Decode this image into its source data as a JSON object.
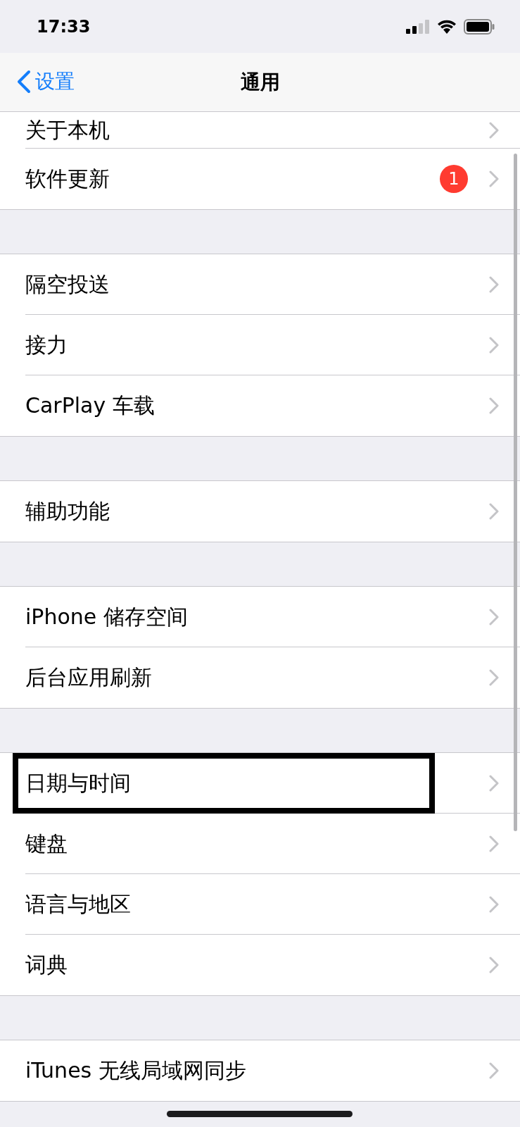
{
  "status_bar": {
    "time": "17:33"
  },
  "nav": {
    "back_label": "设置",
    "title": "通用"
  },
  "groups": [
    [
      {
        "label": "关于本机",
        "highlighted": false,
        "cut": true
      },
      {
        "label": "软件更新",
        "badge": "1",
        "highlighted": false
      }
    ],
    [
      {
        "label": "隔空投送",
        "highlighted": false
      },
      {
        "label": "接力",
        "highlighted": false
      },
      {
        "label": "CarPlay 车载",
        "highlighted": false
      }
    ],
    [
      {
        "label": "辅助功能",
        "highlighted": false
      }
    ],
    [
      {
        "label": "iPhone 储存空间",
        "highlighted": false
      },
      {
        "label": "后台应用刷新",
        "highlighted": false
      }
    ],
    [
      {
        "label": "日期与时间",
        "highlighted": true
      },
      {
        "label": "键盘",
        "highlighted": false
      },
      {
        "label": "语言与地区",
        "highlighted": false
      },
      {
        "label": "词典",
        "highlighted": false
      }
    ],
    [
      {
        "label": "iTunes 无线局域网同步",
        "highlighted": false
      }
    ]
  ]
}
